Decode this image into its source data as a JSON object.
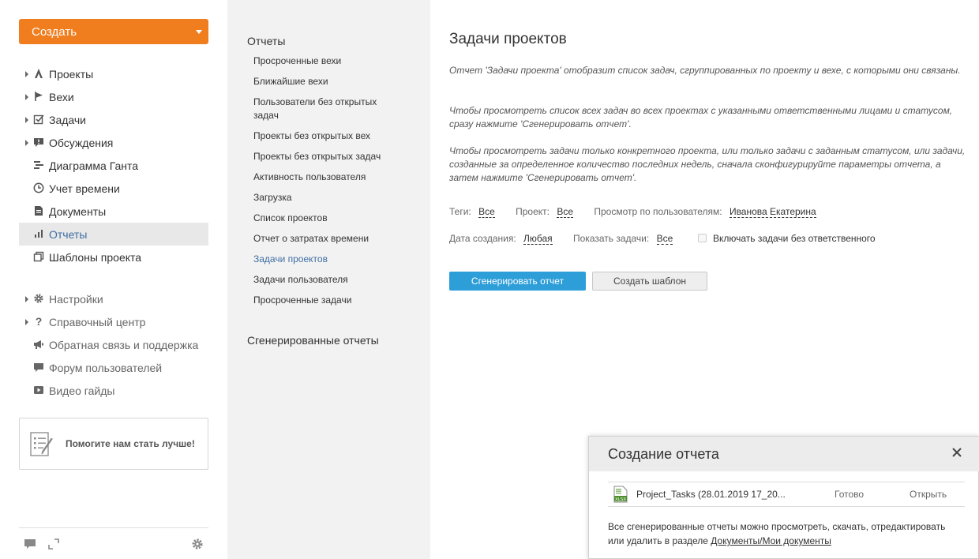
{
  "sidebar": {
    "create_label": "Создать",
    "items": [
      {
        "label": "Проекты",
        "icon": "projects-icon",
        "has_arrow": true
      },
      {
        "label": "Вехи",
        "icon": "flag-icon",
        "has_arrow": true
      },
      {
        "label": "Задачи",
        "icon": "checkbox-icon",
        "has_arrow": true
      },
      {
        "label": "Обсуждения",
        "icon": "discussion-icon",
        "has_arrow": true
      },
      {
        "label": "Диаграмма Ганта",
        "icon": "gantt-icon",
        "has_arrow": false
      },
      {
        "label": "Учет времени",
        "icon": "clock-icon",
        "has_arrow": false
      },
      {
        "label": "Документы",
        "icon": "document-icon",
        "has_arrow": false
      },
      {
        "label": "Отчеты",
        "icon": "bar-chart-icon",
        "has_arrow": false,
        "active": true
      },
      {
        "label": "Шаблоны проекта",
        "icon": "template-icon",
        "has_arrow": false
      }
    ],
    "secondary": [
      {
        "label": "Настройки",
        "icon": "gear-icon",
        "has_arrow": true
      },
      {
        "label": "Справочный центр",
        "icon": "question-icon",
        "has_arrow": true
      },
      {
        "label": "Обратная связь и поддержка",
        "icon": "megaphone-icon",
        "has_arrow": false
      },
      {
        "label": "Форум пользователей",
        "icon": "forum-icon",
        "has_arrow": false
      },
      {
        "label": "Видео гайды",
        "icon": "video-icon",
        "has_arrow": false
      }
    ],
    "help_text": "Помогите нам стать лучше!"
  },
  "reports_panel": {
    "title": "Отчеты",
    "links": [
      "Просроченные вехи",
      "Ближайшие вехи",
      "Пользователи без открытых задач",
      "Проекты без открытых вех",
      "Проекты без открытых задач",
      "Активность пользователя",
      "Загрузка",
      "Список проектов",
      "Отчет о затратах времени",
      "Задачи проектов",
      "Задачи пользователя",
      "Просроченные задачи"
    ],
    "active_link": "Задачи проектов",
    "generated_title": "Сгенерированные отчеты"
  },
  "main": {
    "title": "Задачи проектов",
    "desc1": "Отчет 'Задачи проекта' отобразит список задач, сгруппированных по проекту и вехе, с которыми они связаны.",
    "desc2": "Чтобы просмотреть список всех задач во всех проектах с указанными ответственными лицами и статусом, сразу нажмите 'Сгенерировать отчет'.",
    "desc3": "Чтобы просмотреть задачи только конкретного проекта, или только задачи с заданным статусом, или задачи, созданные за определенное количество последних недель, сначала сконфигурируйте параметры отчета, а затем нажмите 'Сгенерировать отчет'.",
    "filters": {
      "tags_label": "Теги:",
      "tags_value": "Все",
      "project_label": "Проект:",
      "project_value": "Все",
      "users_label": "Просмотр по пользователям:",
      "users_value": "Иванова Екатерина",
      "created_label": "Дата создания:",
      "created_value": "Любая",
      "show_label": "Показать задачи:",
      "show_value": "Все",
      "include_label": "Включать задачи без ответственного"
    },
    "generate_label": "Сгенерировать отчет",
    "template_label": "Создать шаблон"
  },
  "popup": {
    "title": "Создание отчета",
    "file_name": "Project_Tasks (28.01.2019 17_20...",
    "file_status": "Готово",
    "file_open": "Открыть",
    "note_text": "Все сгенерированные отчеты можно просмотреть, скачать, отредактировать или удалить в разделе ",
    "note_link": "Документы/Мои документы"
  },
  "colors": {
    "accent_orange": "#f07d1e",
    "accent_blue": "#2d9ed8",
    "link_active": "#3e6ea3"
  }
}
